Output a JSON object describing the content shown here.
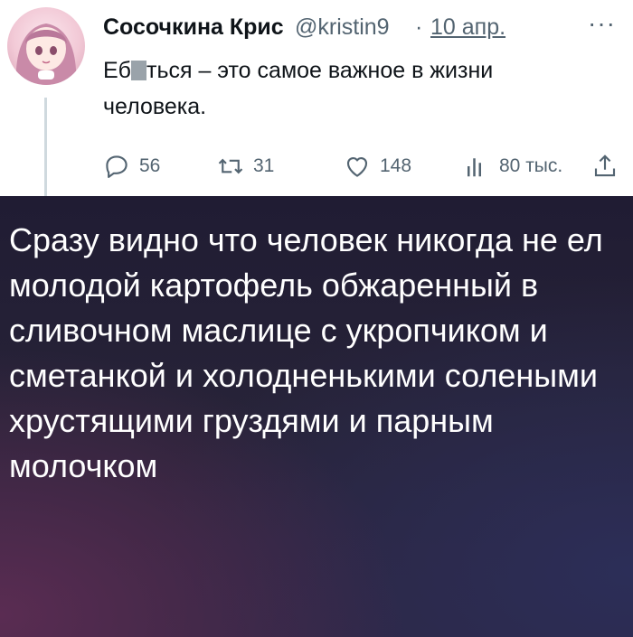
{
  "tweet": {
    "author_name": "Сосочкина Крис",
    "handle": "@kristin9",
    "separator": "·",
    "date": "10 апр.",
    "more_label": "···",
    "text_line1_part1": "Еб",
    "text_line1_part2": "ться – это самое важное в жизни",
    "text_line2": "человека.",
    "actions": {
      "replies": "56",
      "retweets": "31",
      "likes": "148",
      "views": "80 тыс."
    }
  },
  "caption": {
    "text": "Сразу видно что человек никогда не ел молодой картофель обжаренный в сливочном маслице с укропчиком и сметанкой и холодненькими солеными хрустящими груздями и парным молочком"
  },
  "colors": {
    "text_primary": "#0f1419",
    "text_secondary": "#536471",
    "caption_bg": "#241f38"
  },
  "icons": [
    "reply-icon",
    "retweet-icon",
    "like-icon",
    "views-icon",
    "share-icon",
    "more-icon"
  ]
}
